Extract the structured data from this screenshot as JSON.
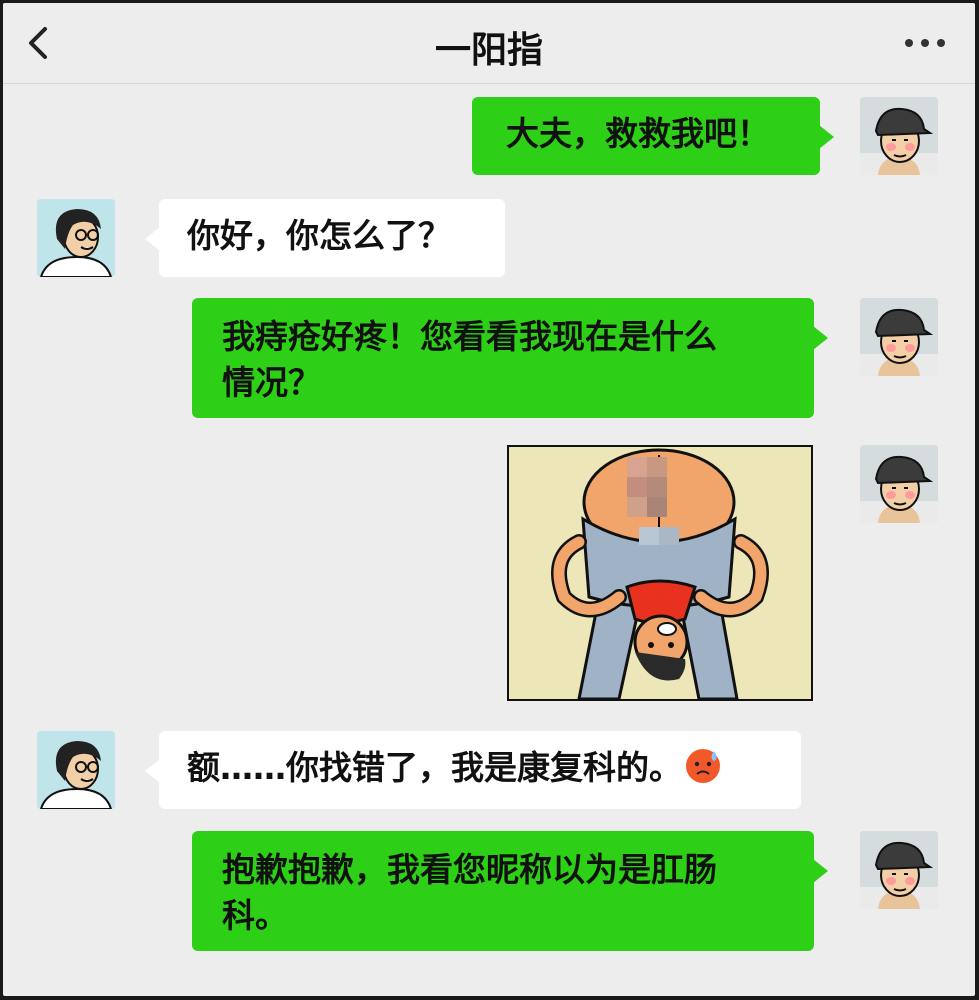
{
  "header": {
    "title": "一阳指"
  },
  "messages": {
    "m1": "大夫，救救我吧！",
    "m2": "你好，你怎么了？",
    "m3_line1": "我痔疮好疼！您看看我现在是什么",
    "m3_line2": "情况？",
    "m5": "额……你找错了，我是康复科的。",
    "m6_line1": "抱歉抱歉，我看您昵称以为是肛肠",
    "m6_line2": "科。"
  },
  "icons": {
    "back": "chevron-left-icon",
    "more": "more-dots-icon",
    "emoji": "anxious-sweat-emoji-icon"
  },
  "colors": {
    "sent_bubble": "#2ecf17",
    "received_bubble": "#ffffff",
    "background": "#ededed"
  }
}
